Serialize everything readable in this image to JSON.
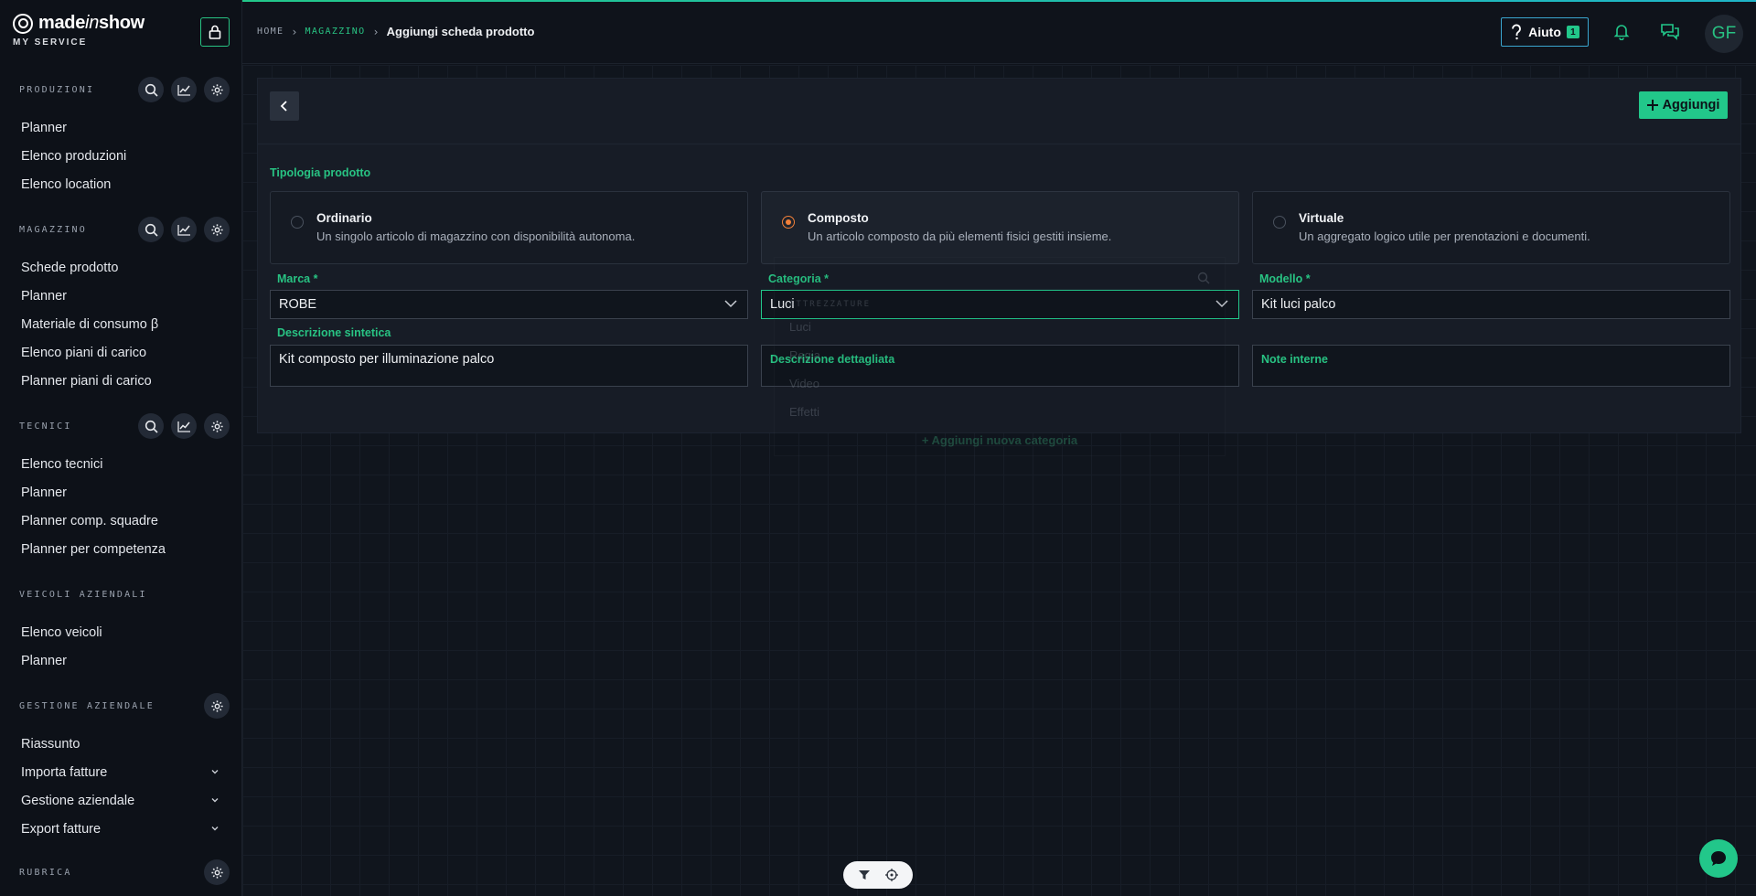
{
  "brand": {
    "name_main": "made",
    "name_italic": "in",
    "name_end": "show",
    "subtitle": "MY SERVICE"
  },
  "sidebar": {
    "sections": [
      {
        "label": "PRODUZIONI",
        "tools": [
          "search-icon",
          "chart-icon",
          "gear-icon"
        ],
        "items": [
          {
            "label": "Planner"
          },
          {
            "label": "Elenco produzioni"
          },
          {
            "label": "Elenco location"
          }
        ]
      },
      {
        "label": "MAGAZZINO",
        "tools": [
          "search-icon",
          "chart-icon",
          "gear-icon"
        ],
        "items": [
          {
            "label": "Schede prodotto"
          },
          {
            "label": "Planner"
          },
          {
            "label": "Materiale di consumo β"
          },
          {
            "label": "Elenco piani di carico"
          },
          {
            "label": "Planner piani di carico"
          }
        ]
      },
      {
        "label": "TECNICI",
        "tools": [
          "search-icon",
          "chart-icon",
          "gear-icon"
        ],
        "items": [
          {
            "label": "Elenco tecnici"
          },
          {
            "label": "Planner"
          },
          {
            "label": "Planner comp. squadre"
          },
          {
            "label": "Planner per competenza"
          }
        ]
      },
      {
        "label": "VEICOLI AZIENDALI",
        "tools": [],
        "items": [
          {
            "label": "Elenco veicoli"
          },
          {
            "label": "Planner"
          }
        ]
      },
      {
        "label": "GESTIONE AZIENDALE",
        "tools": [
          "gear-icon"
        ],
        "items": [
          {
            "label": "Riassunto",
            "expand": false
          },
          {
            "label": "Importa fatture",
            "expand": true
          },
          {
            "label": "Gestione aziendale",
            "expand": true
          },
          {
            "label": "Export fatture",
            "expand": true
          }
        ]
      },
      {
        "label": "RUBRICA",
        "tools": [
          "gear-icon"
        ],
        "items": []
      }
    ]
  },
  "topbar": {
    "breadcrumb": {
      "home": "HOME",
      "section": "MAGAZZINO",
      "current": "Aggiungi scheda prodotto"
    },
    "help_label": "Aiuto",
    "help_count": "1",
    "avatar_initials": "GF"
  },
  "form": {
    "add_button": "Aggiungi",
    "type_section_label": "Tipologia prodotto",
    "types": [
      {
        "title": "Ordinario",
        "desc": "Un singolo articolo di magazzino con disponibilità autonoma.",
        "selected": false
      },
      {
        "title": "Composto",
        "desc": "Un articolo composto da più elementi fisici gestiti insieme.",
        "selected": true
      },
      {
        "title": "Virtuale",
        "desc": "Un aggregato logico utile per prenotazioni e documenti.",
        "selected": false
      }
    ],
    "marca": {
      "label": "Marca *",
      "value": "ROBE"
    },
    "categoria": {
      "label": "Categoria *",
      "value": "Luci"
    },
    "modello": {
      "label": "Modello *",
      "value": "Kit luci palco"
    },
    "descrizione_sintetica": {
      "label": "Descrizione sintetica",
      "value": "Kit composto per illuminazione palco"
    },
    "descrizione_dettagliata": {
      "label": "Descrizione dettagliata"
    },
    "note_interne": {
      "label": "Note interne"
    }
  },
  "dropdown": {
    "group_label": "ATTREZZATURE",
    "options": [
      "Luci",
      "Regia",
      "Video",
      "Effetti"
    ],
    "add_label": "+ Aggiungi nuova categoria"
  },
  "colors": {
    "accent": "#22c78a",
    "radio_selected": "#f2803a",
    "help_border": "#3aa6d0"
  }
}
